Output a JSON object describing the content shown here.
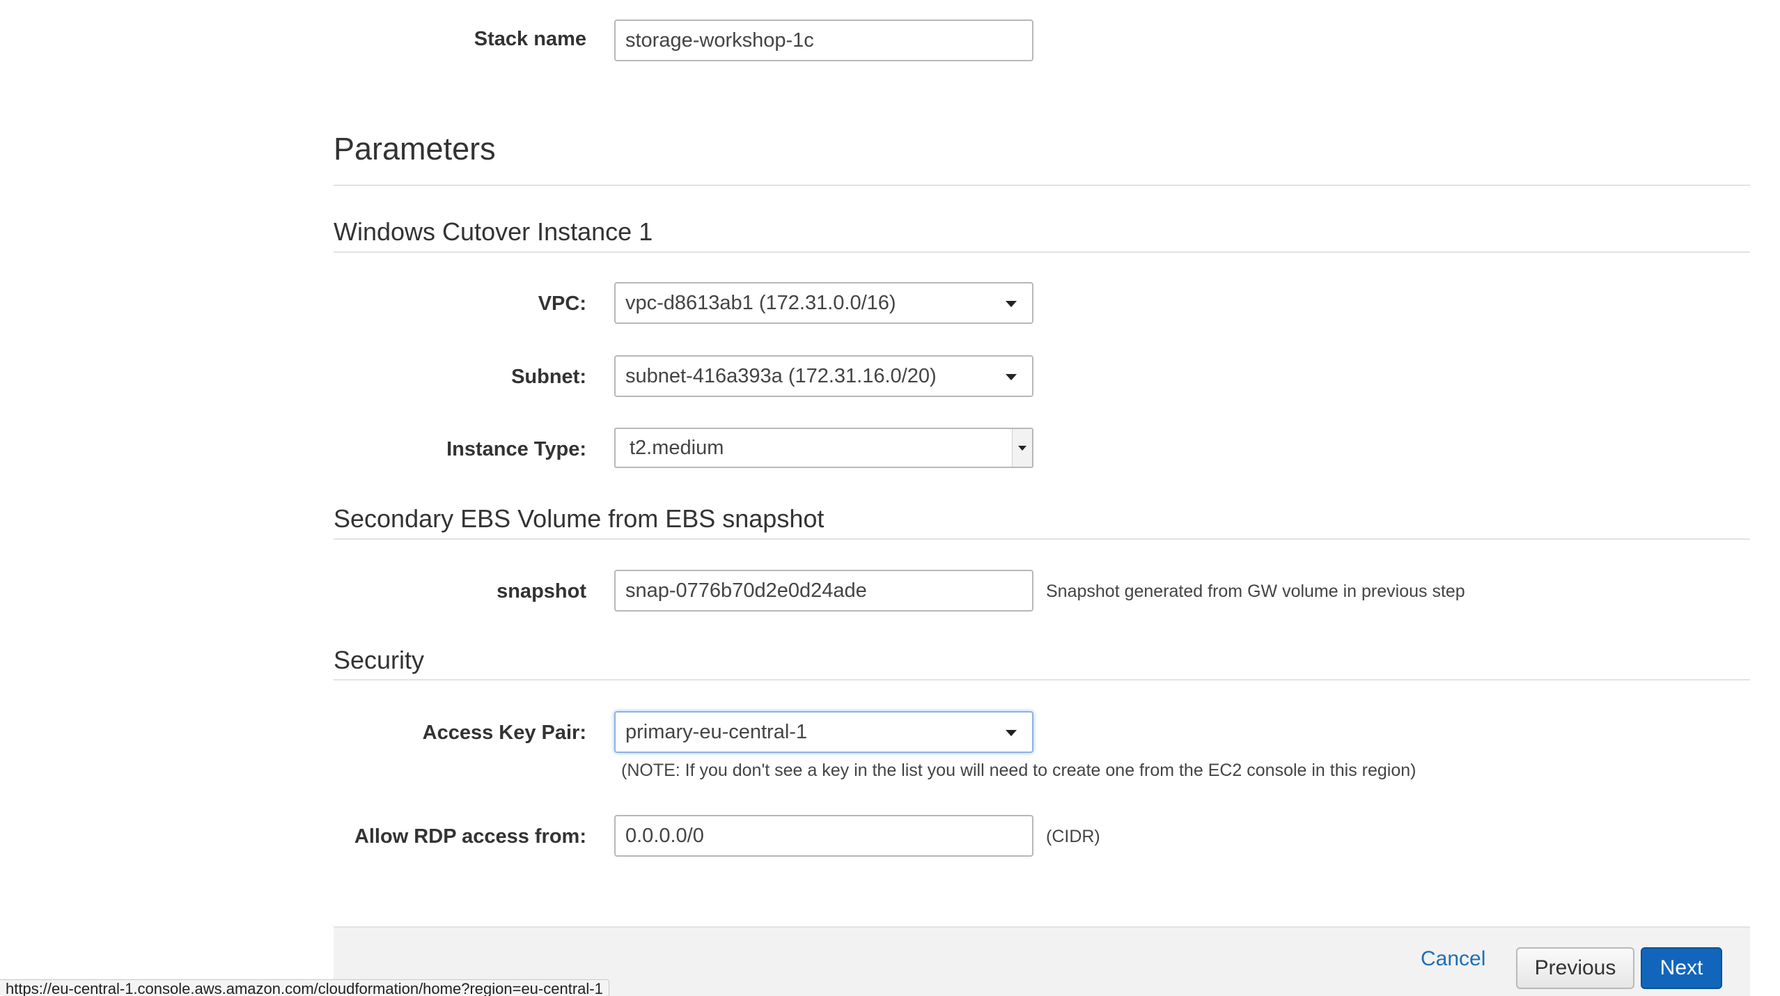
{
  "stack": {
    "label": "Stack name",
    "value": "storage-workshop-1c"
  },
  "parameters_title": "Parameters",
  "sections": {
    "windows": {
      "title": "Windows Cutover Instance 1",
      "vpc_label": "VPC:",
      "vpc_value": "vpc-d8613ab1 (172.31.0.0/16)",
      "subnet_label": "Subnet:",
      "subnet_value": "subnet-416a393a (172.31.16.0/20)",
      "instance_type_label": "Instance Type:",
      "instance_type_value": "t2.medium"
    },
    "ebs": {
      "title": "Secondary EBS Volume from EBS snapshot",
      "snapshot_label": "snapshot",
      "snapshot_value": "snap-0776b70d2e0d24ade",
      "snapshot_help": "Snapshot generated from GW volume in previous step"
    },
    "security": {
      "title": "Security",
      "key_pair_label": "Access Key Pair:",
      "key_pair_value": "primary-eu-central-1",
      "key_pair_note": "(NOTE: If you don't see a key in the list you will need to create one from the EC2 console in this region)",
      "rdp_label": "Allow RDP access from:",
      "rdp_value": "0.0.0.0/0",
      "rdp_help": "(CIDR)"
    }
  },
  "footer": {
    "cancel_label": "Cancel",
    "previous_label": "Previous",
    "next_label": "Next"
  },
  "status_bar": {
    "url": "https://eu-central-1.console.aws.amazon.com/cloudformation/home?region=eu-central-1"
  },
  "colors": {
    "primary_button": "#1166bb",
    "link": "#1f6fb5",
    "focus_ring": "#8fb2e3"
  }
}
